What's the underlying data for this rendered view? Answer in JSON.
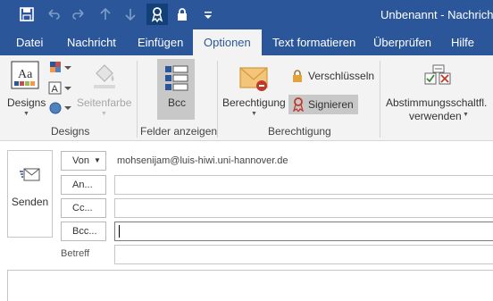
{
  "window": {
    "title": "Unbenannt - Nachricht"
  },
  "quick_access": {
    "save": "save-icon",
    "undo": "undo-icon",
    "redo": "redo-icon",
    "up": "arrow-up-icon",
    "down": "arrow-down-icon",
    "ribbon_pin": "ribbon-icon",
    "lock": "lock-icon",
    "customize": "customize-icon"
  },
  "tabs": [
    "Datei",
    "Nachricht",
    "Einfügen",
    "Optionen",
    "Text formatieren",
    "Überprüfen",
    "Hilfe"
  ],
  "active_tab": "Optionen",
  "ribbon": {
    "designs": {
      "button_label": "Designs",
      "group_label": "Designs",
      "page_color_label": "Seitenfarbe"
    },
    "fields": {
      "bcc_label": "Bcc",
      "group_label": "Felder anzeigen"
    },
    "permission": {
      "button_label": "Berechtigung",
      "encrypt_label": "Verschlüsseln",
      "sign_label": "Signieren",
      "group_label": "Berechtigung"
    },
    "voting": {
      "label_line1": "Abstimmungsschaltfl.",
      "label_line2": "verwenden"
    }
  },
  "compose": {
    "send_label": "Senden",
    "from_label": "Von",
    "from_value": "mohsenijam@luis-hiwi.uni-hannover.de",
    "to_label": "An...",
    "cc_label": "Cc...",
    "bcc_label": "Bcc...",
    "subject_label": "Betreff",
    "to_value": "",
    "cc_value": "",
    "bcc_value": "",
    "subject_value": ""
  },
  "colors": {
    "accent": "#2b579a",
    "ribbon_bg": "#f3f3f3",
    "selected": "#c8c8c8"
  }
}
